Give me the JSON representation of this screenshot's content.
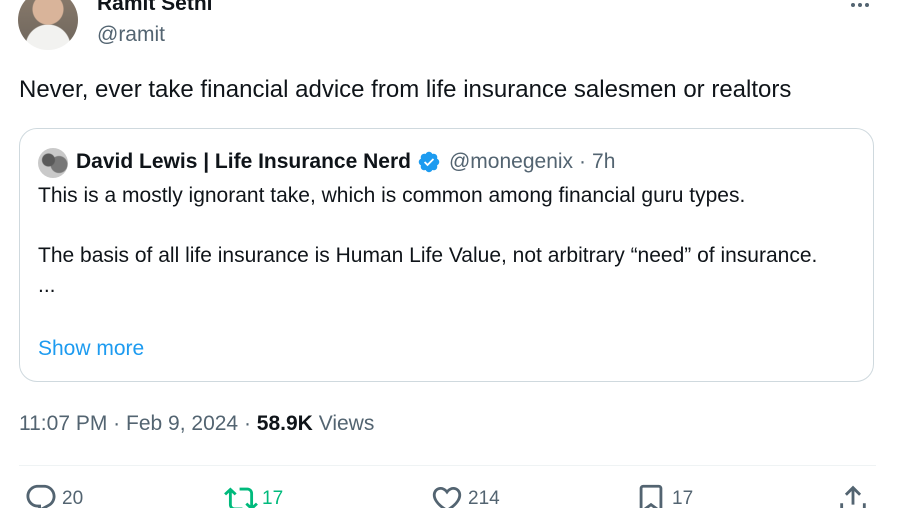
{
  "author": {
    "display_name": "Ramit Sethi",
    "handle": "@ramit"
  },
  "tweet": {
    "text": "Never, ever take financial advice from life insurance salesmen or realtors"
  },
  "quoted_tweet": {
    "display_name": "David Lewis | Life Insurance Nerd",
    "handle": "@monegenix",
    "separator": "·",
    "time": "7h",
    "paragraph_1": "This is a mostly ignorant take, which is common among financial guru types.",
    "paragraph_2": "The basis of all life insurance is Human Life Value, not arbitrary “need” of insurance.",
    "ellipsis": "...",
    "show_more": "Show more"
  },
  "meta": {
    "time": "11:07 PM",
    "sep1": "·",
    "date": "Feb 9, 2024",
    "sep2": "·",
    "views_count": "58.9K",
    "views_label": "Views"
  },
  "actions": {
    "replies": "20",
    "retweets": "17",
    "likes": "214",
    "bookmarks": "17"
  },
  "colors": {
    "accent": "#1d9bf0",
    "retweet_active": "#00ba7c",
    "text_primary": "#0f1419",
    "text_secondary": "#536471",
    "border": "#cfd9de"
  },
  "icons": {
    "more": "more-horizontal-icon",
    "verified": "verified-badge-icon",
    "reply": "reply-icon",
    "retweet": "retweet-icon",
    "like": "heart-icon",
    "bookmark": "bookmark-icon",
    "share": "share-icon"
  }
}
